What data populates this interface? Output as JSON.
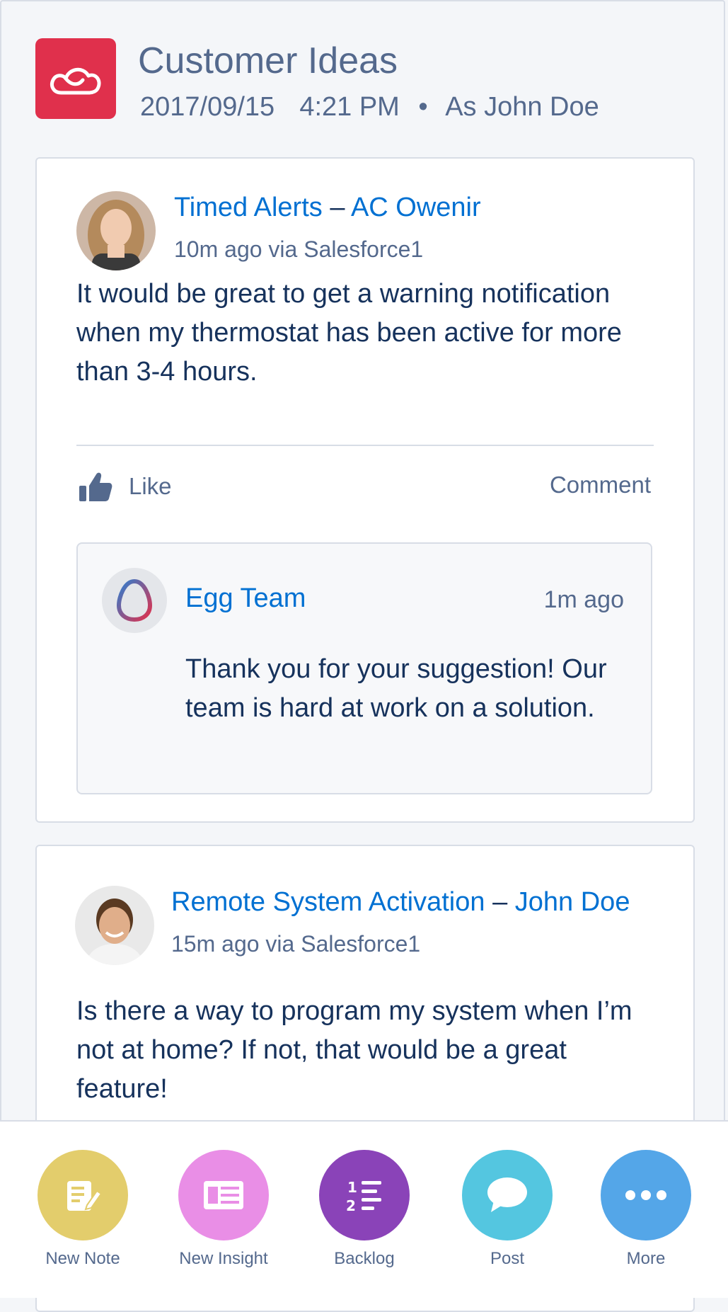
{
  "header": {
    "title": "Customer Ideas",
    "date": "2017/09/15",
    "time": "4:21 PM",
    "separator": "•",
    "as_user": "As John Doe",
    "logo_icon": "cloud-icon",
    "logo_color": "#e0304c"
  },
  "posts": [
    {
      "topic": "Timed Alerts",
      "dash": "–",
      "author": "AC Owenir",
      "meta": "10m ago via Salesforce1",
      "body": "It would be great to get a warning notification when my thermostat has been active for more than 3-4 hours.",
      "like_label": "Like",
      "comment_label": "Comment",
      "comment": {
        "author": "Egg Team",
        "time": "1m ago",
        "body": "Thank you for your suggestion! Our team is hard at work on a solution."
      }
    },
    {
      "topic": "Remote System Activation",
      "dash": "–",
      "author": "John Doe",
      "meta": "15m ago via Salesforce1",
      "body": "Is there a way to program my system when I’m not at home? If not, that would be a great feature!"
    }
  ],
  "actions": [
    {
      "label": "New Note",
      "icon": "note-icon",
      "color": "#e3cd6c"
    },
    {
      "label": "New Insight",
      "icon": "insight-icon",
      "color": "#e98ee6"
    },
    {
      "label": "Backlog",
      "icon": "ordered-list-icon",
      "color": "#8a43b8"
    },
    {
      "label": "Post",
      "icon": "chat-bubble-icon",
      "color": "#54c6e0"
    },
    {
      "label": "More",
      "icon": "more-dots-icon",
      "color": "#54a6e8"
    }
  ],
  "colors": {
    "link": "#0070d2",
    "text": "#16325c",
    "muted": "#54698d"
  }
}
